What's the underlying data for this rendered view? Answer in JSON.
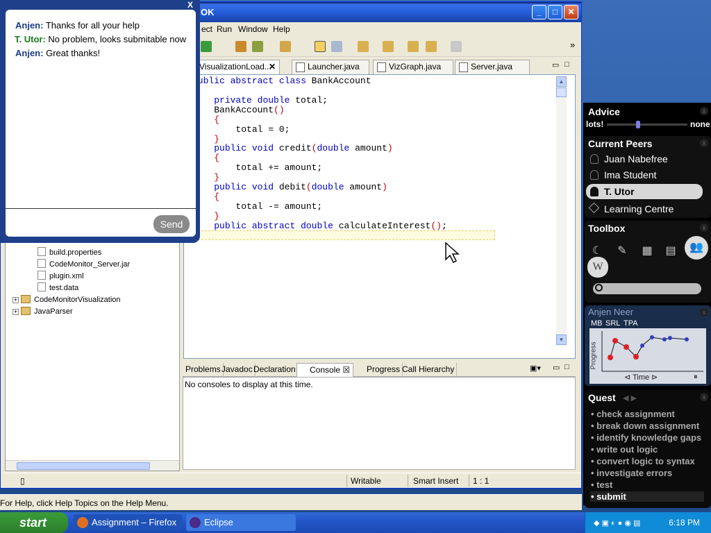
{
  "eclipse": {
    "title": "OK",
    "menus": [
      "ect",
      "Run",
      "Window",
      "Help"
    ],
    "editor_tabs": [
      "VisualizationLoad...",
      "Launcher.java",
      "VizGraph.java",
      "Server.java"
    ],
    "code_lines": [
      "public abstract class BankAccount",
      "{",
      "    private double total;",
      "    BankAccount()",
      "    {",
      "        total = 0;",
      "    }",
      "    public void credit(double amount)",
      "    {",
      "        total += amount;",
      "    }",
      "    public void debit(double amount)",
      "    {",
      "        total -= amount;",
      "    }",
      "    public abstract double calculateInterest();",
      "}"
    ],
    "tree_items": [
      "build.properties",
      "CodeMonitor_Server.jar",
      "plugin.xml",
      "test.data",
      "CodeMonitorVisualization",
      "JavaParser"
    ],
    "console_tabs": [
      "Problems",
      "Javadoc",
      "Declaration",
      "Console",
      "Progress",
      "Call Hierarchy"
    ],
    "console_text": "No consoles to display at this time.",
    "status": {
      "writable": "Writable",
      "insert": "Smart Insert",
      "position": "1 : 1"
    },
    "help_text": "For Help, click Help Topics on the Help Menu."
  },
  "chat": {
    "close": "X",
    "messages": [
      {
        "who": "Anjen:",
        "text": "Thanks for all your help"
      },
      {
        "who": "T. Utor:",
        "text": "No problem, looks submitable now"
      },
      {
        "who": "Anjen:",
        "text": "Great thanks!"
      }
    ],
    "send_label": "Send"
  },
  "panel": {
    "advice_title": "Advice",
    "advice_left": "lots!",
    "advice_right": "none",
    "advice_level": 0.36,
    "peers_title": "Current Peers",
    "peers": [
      "Juan Nabefree",
      "Ima Student",
      "T. Utor",
      "Learning Centre"
    ],
    "selected_peer": "T. Utor",
    "toolbox_title": "Toolbox",
    "progress_user": "Anjen Neer",
    "progress_tabs": [
      "MB",
      "SRL",
      "TPA"
    ],
    "progress_ylabel": "Progress",
    "progress_xlabel": "Time",
    "quest_title": "Quest",
    "quest_items": [
      "check assignment",
      "break down assignment",
      "identify knowledge gaps",
      "write out logic",
      "convert logic to syntax",
      "investigate errors",
      "test",
      "submit"
    ],
    "quest_current": "submit"
  },
  "taskbar": {
    "start": "start",
    "tasks": [
      "Assignment – Firefox",
      "Eclipse"
    ],
    "clock": "6:18 PM"
  }
}
